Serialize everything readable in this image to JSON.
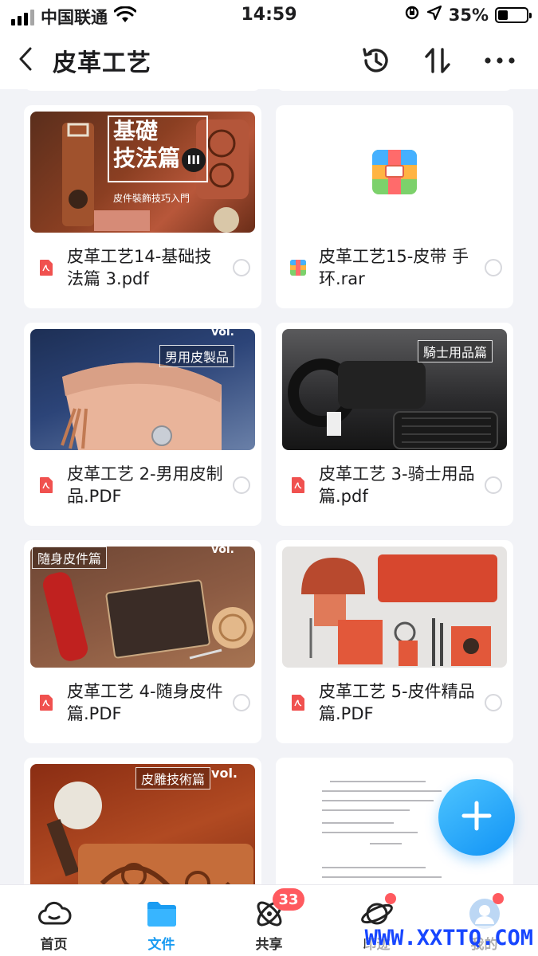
{
  "status_bar": {
    "carrier": "中国联通",
    "time": "14:59",
    "battery": "35%",
    "battery_level": 0.35
  },
  "header": {
    "title": "皮革工艺",
    "icons": [
      "back-chevron-icon",
      "history-icon",
      "sort-icon",
      "more-icon"
    ]
  },
  "files": [
    {
      "name": "皮革工艺14-基础技法篇 3.pdf",
      "type": "pdf",
      "cover_title": "基礎 技法篇",
      "cover_volume": "III",
      "cover_subtitle": "皮件裝飾技巧入門"
    },
    {
      "name": "皮革工艺15-皮带 手环.rar",
      "type": "rar"
    },
    {
      "name": "皮革工艺 2-男用皮制品.PDF",
      "type": "pdf",
      "cover_tag": "男用皮製品",
      "cover_vol": "vol."
    },
    {
      "name": "皮革工艺 3-骑士用品篇.pdf",
      "type": "pdf",
      "cover_tag": "騎士用品篇"
    },
    {
      "name": "皮革工艺 4-随身皮件篇.PDF",
      "type": "pdf",
      "cover_tag": "隨身皮件篇",
      "cover_vol": "vol."
    },
    {
      "name": "皮革工艺 5-皮件精品篇.PDF",
      "type": "pdf"
    },
    {
      "type": "pdf",
      "cover_tag": "皮雕技術篇",
      "cover_vol": "vol."
    },
    {
      "type": "pdf"
    }
  ],
  "tabs": [
    {
      "label": "首页",
      "icon": "cloud-icon",
      "active": false
    },
    {
      "label": "文件",
      "icon": "folder-icon",
      "active": true
    },
    {
      "label": "共享",
      "icon": "share-atom-icon",
      "active": false,
      "badge": "33"
    },
    {
      "label": "印迹",
      "icon": "planet-icon",
      "active": false,
      "dot": true
    },
    {
      "label": "我的",
      "icon": "avatar-icon",
      "active": false,
      "dot": true
    }
  ],
  "fab": {
    "icon": "plus-icon"
  },
  "watermark": "WWW.XXTTQ.COM",
  "colors": {
    "accent": "#1a9cf2",
    "badge": "#ff5a5f",
    "pdf": "#f0514f"
  }
}
